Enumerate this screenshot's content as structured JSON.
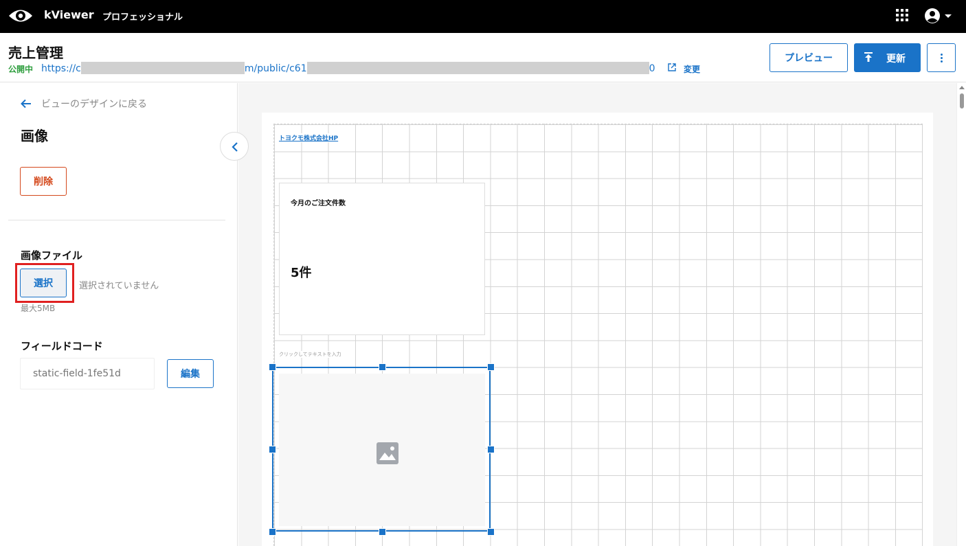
{
  "topbar": {
    "app_name": "kViewer",
    "edition": "プロフェッショナル",
    "logo_icon": "eye-logo-icon",
    "apps_icon": "grid-apps-icon",
    "account_icon": "account-circle-icon"
  },
  "header": {
    "title": "売上管理",
    "status": "公開中",
    "url_start": "https://c",
    "url_middle": "m/public/c61",
    "url_end": "0",
    "change_label": "変更",
    "preview_label": "プレビュー",
    "update_label": "更新"
  },
  "panel": {
    "back_label": "ビューのデザインに戻る",
    "title": "画像",
    "delete_label": "削除",
    "image_file_label": "画像ファイル",
    "select_label": "選択",
    "no_file_text": "選択されていません",
    "max_size_text": "最大5MB",
    "field_code_label": "フィールドコード",
    "field_code_placeholder": "static-field-1fe51d",
    "edit_label": "編集"
  },
  "canvas": {
    "hp_link": "トヨクモ株式会社HP",
    "kpi_title": "今月のご注文件数",
    "kpi_value": "5件",
    "text_placeholder": "クリックしてテキストを入力",
    "image_placeholder_icon": "image-placeholder-icon"
  },
  "colors": {
    "accent": "#1a73c8",
    "danger": "#d4481b",
    "status_green": "#2e9e3e",
    "highlight_red": "#e02020"
  }
}
